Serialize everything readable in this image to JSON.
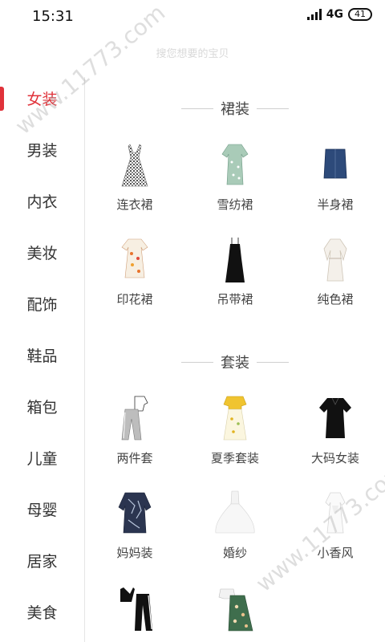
{
  "status": {
    "time": "15:31",
    "network": "4G",
    "battery": "41"
  },
  "search_hint": "搜您想要的宝贝",
  "sidebar": {
    "items": [
      "女装",
      "男装",
      "内衣",
      "美妆",
      "配饰",
      "鞋品",
      "箱包",
      "儿童",
      "母婴",
      "居家",
      "美食"
    ],
    "active_index": 0,
    "accent": "#e0323a"
  },
  "sections": [
    {
      "title": "裙装",
      "items": [
        {
          "label": "连衣裙",
          "icon": "gingham-dress-icon"
        },
        {
          "label": "雪纺裙",
          "icon": "chiffon-dress-icon"
        },
        {
          "label": "半身裙",
          "icon": "denim-skirt-icon"
        },
        {
          "label": "印花裙",
          "icon": "print-dress-icon"
        },
        {
          "label": "吊带裙",
          "icon": "slip-dress-icon"
        },
        {
          "label": "纯色裙",
          "icon": "plain-dress-icon"
        }
      ]
    },
    {
      "title": "套装",
      "items": [
        {
          "label": "两件套",
          "icon": "two-piece-icon"
        },
        {
          "label": "夏季套装",
          "icon": "summer-set-icon"
        },
        {
          "label": "大码女装",
          "icon": "plus-size-tee-icon"
        },
        {
          "label": "妈妈装",
          "icon": "mom-outfit-icon"
        },
        {
          "label": "婚纱",
          "icon": "wedding-dress-icon"
        },
        {
          "label": "小香风",
          "icon": "tweed-style-icon"
        },
        {
          "label": "",
          "icon": "sport-set-icon"
        },
        {
          "label": "",
          "icon": "floral-set-icon"
        }
      ]
    }
  ],
  "watermark": "www.11773.com"
}
